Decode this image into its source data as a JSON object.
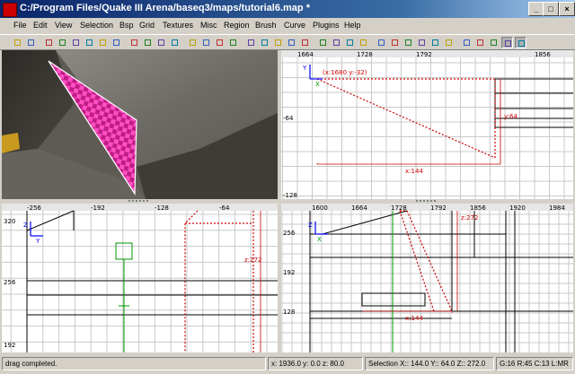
{
  "window": {
    "title": "C:/Program Files/Quake III Arena/baseq3/maps/tutorial6.map *",
    "minimize_glyph": "_",
    "maximize_glyph": "□",
    "close_glyph": "×"
  },
  "menu": [
    "File",
    "Edit",
    "View",
    "Selection",
    "Bsp",
    "Grid",
    "Textures",
    "Misc",
    "Region",
    "Brush",
    "Curve",
    "Plugins",
    "Help"
  ],
  "toolbar_icons": [
    "open-icon",
    "save-icon",
    "flip-x-icon",
    "flip-y-icon",
    "flip-z-icon",
    "rotate-x-icon",
    "rotate-y-icon",
    "rotate-z-icon",
    "select-complete-tall-icon",
    "select-touching-icon",
    "select-partial-tall-icon",
    "select-inside-icon",
    "csg-subtract-icon",
    "csg-merge-icon",
    "hollow-icon",
    "clipper-icon",
    "change-views-icon",
    "texture-view-icon",
    "camera-icon",
    "cube-clip-icon",
    "free-rotate-icon",
    "free-scale-icon",
    "scale-x-icon",
    "scale-y-icon",
    "scale-z-icon",
    "patch-bend-icon",
    "insert-patch-icon",
    "delete-patch-icon",
    "patch-cap-icon",
    "weld-icon",
    "drill-icon",
    "texture-lock-icon",
    "rotation-lock-icon",
    "show-entities-icon",
    "drag-edges-icon",
    "drag-vertices-icon"
  ],
  "views": {
    "top": {
      "ruler_x": [
        "1664",
        "1728",
        "1792",
        "1856"
      ],
      "ruler_y": [
        "-64",
        "-128"
      ],
      "origin_label": "(x:1680  y:-32)",
      "dim_x": "x:144",
      "dim_y": "y:64",
      "axis_h": "X",
      "axis_v": "Y"
    },
    "side": {
      "ruler_x": [
        "-256",
        "-192",
        "-128",
        "-64"
      ],
      "ruler_y": [
        "320",
        "256",
        "192"
      ],
      "dim_z": "z:272",
      "axis_h": "Y",
      "axis_v": "Z"
    },
    "front": {
      "ruler_x": [
        "1600",
        "1664",
        "1728",
        "1792",
        "1856",
        "1920",
        "1984"
      ],
      "ruler_y": [
        "256",
        "192",
        "128"
      ],
      "dim_z": "z:272",
      "dim_x": "x:144",
      "axis_h": "X",
      "axis_v": "Z"
    }
  },
  "status": {
    "message": "drag completed.",
    "coords": "x:  1936.0  y:  0.0  z:  80.0",
    "selection": "Selection X:: 144.0  Y:: 64.0  Z:: 272.0",
    "grid": "G:16 R:45 C:13 L:MR"
  },
  "colors": {
    "grid": "#c8c8c8",
    "grid_major": "#202020",
    "selection": "#cc0000",
    "entity": "#009900",
    "texture_pink": "#ff33b4",
    "axis_blue": "#0000ff"
  }
}
